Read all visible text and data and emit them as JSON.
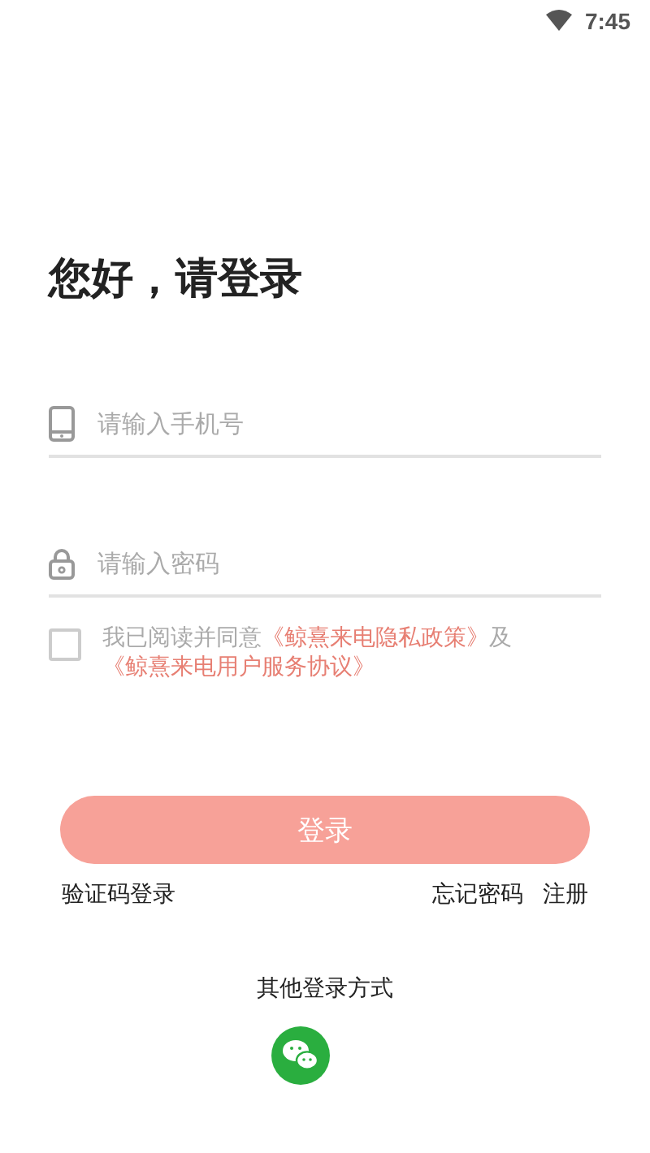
{
  "status_bar": {
    "time": "7:45"
  },
  "title": "您好，请登录",
  "fields": [
    {
      "kind": "phone",
      "placeholder": "请输入手机号"
    },
    {
      "kind": "password",
      "placeholder": "请输入密码"
    }
  ],
  "agreement": {
    "checked": false,
    "parts": [
      {
        "kind": "plain",
        "text": "我已阅读并同意"
      },
      {
        "kind": "link",
        "text": "《鲸熹来电隐私政策》"
      },
      {
        "kind": "plain",
        "text": "及"
      },
      {
        "kind": "link",
        "text": "《鲸熹来电用户服务协议》"
      }
    ]
  },
  "login_button": "登录",
  "links": {
    "left": "验证码登录",
    "right": [
      "忘记密码",
      "注册"
    ]
  },
  "other_login": {
    "label": "其他登录方式",
    "methods": [
      {
        "kind": "wechat"
      }
    ]
  }
}
